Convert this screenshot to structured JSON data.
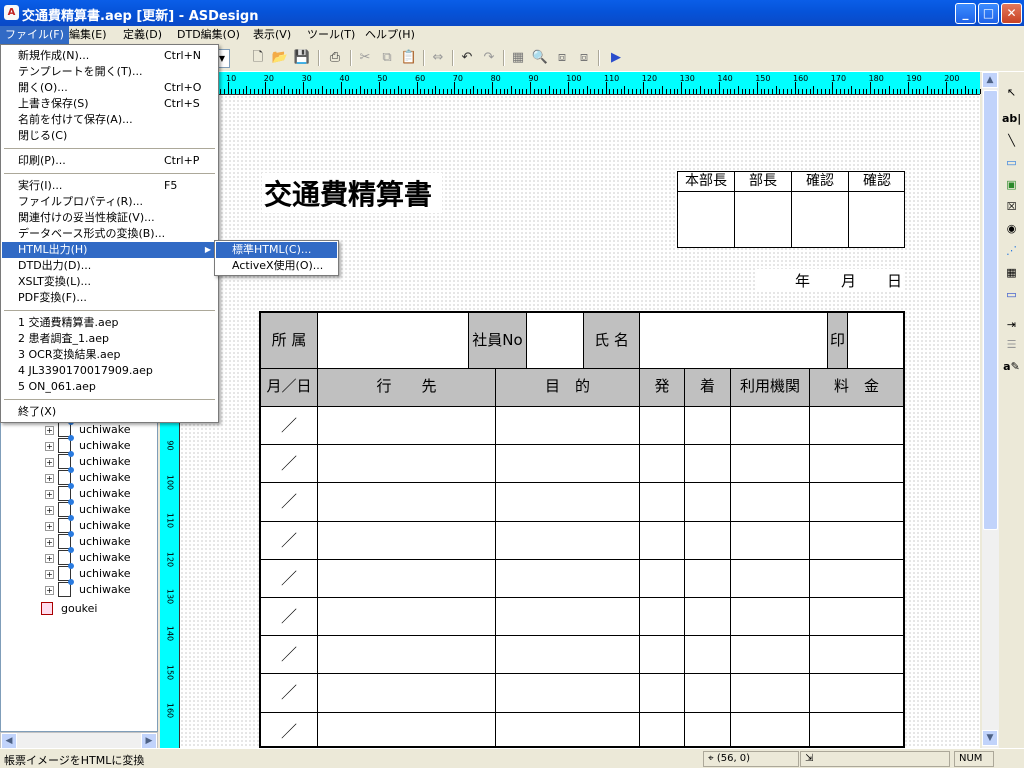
{
  "window": {
    "title": "交通費精算書.aep [更新] - ASDesign",
    "minimize": "_",
    "maximize": "□",
    "close": "✕"
  },
  "menubar": [
    {
      "label": "ファイル(F)"
    },
    {
      "label": "編集(E)"
    },
    {
      "label": "定義(D)"
    },
    {
      "label": "DTD編集(O)"
    },
    {
      "label": "表示(V)"
    },
    {
      "label": "ツール(T)"
    },
    {
      "label": "ヘルプ(H)"
    }
  ],
  "file_menu": {
    "group1": [
      {
        "label": "新規作成(N)...",
        "shortcut": "Ctrl+N"
      },
      {
        "label": "テンプレートを開く(T)...",
        "shortcut": ""
      },
      {
        "label": "開く(O)...",
        "shortcut": "Ctrl+O"
      },
      {
        "label": "上書き保存(S)",
        "shortcut": "Ctrl+S"
      },
      {
        "label": "名前を付けて保存(A)...",
        "shortcut": ""
      },
      {
        "label": "閉じる(C)",
        "shortcut": ""
      }
    ],
    "group2": [
      {
        "label": "印刷(P)...",
        "shortcut": "Ctrl+P"
      }
    ],
    "group3": [
      {
        "label": "実行(I)...",
        "shortcut": "F5"
      },
      {
        "label": "ファイルプロパティ(R)...",
        "shortcut": ""
      },
      {
        "label": "関連付けの妥当性検証(V)...",
        "shortcut": ""
      },
      {
        "label": "データベース形式の変換(B)...",
        "shortcut": ""
      },
      {
        "label": "HTML出力(H)",
        "shortcut": "",
        "highlighted": true,
        "has_submenu": true
      },
      {
        "label": "DTD出力(D)...",
        "shortcut": ""
      },
      {
        "label": "XSLT変換(L)...",
        "shortcut": ""
      },
      {
        "label": "PDF変換(F)...",
        "shortcut": ""
      }
    ],
    "recent": [
      {
        "label": "1 交通費精算書.aep"
      },
      {
        "label": "2 患者調査_1.aep"
      },
      {
        "label": "3 OCR変換結果.aep"
      },
      {
        "label": "4 JL3390170017909.aep"
      },
      {
        "label": "5 ON_061.aep"
      }
    ],
    "exit": {
      "label": "終了(X)"
    }
  },
  "html_submenu": [
    {
      "label": "標準HTML(C)...",
      "highlighted": true
    },
    {
      "label": "ActiveX使用(O)...",
      "highlighted": false
    }
  ],
  "tree": {
    "items": [
      "uchiwake",
      "uchiwake",
      "uchiwake",
      "uchiwake",
      "uchiwake",
      "uchiwake",
      "uchiwake",
      "uchiwake",
      "uchiwake",
      "uchiwake",
      "uchiwake"
    ],
    "last": "goukei"
  },
  "hruler": {
    "labels": [
      "10",
      "20",
      "30",
      "40",
      "50",
      "60",
      "70",
      "80",
      "90",
      "100",
      "110",
      "120",
      "130",
      "140",
      "150",
      "160",
      "170",
      "180",
      "190",
      "200"
    ]
  },
  "vruler": {
    "labels": [
      "90",
      "100",
      "110",
      "120",
      "130",
      "140",
      "150",
      "160"
    ]
  },
  "document": {
    "title": "交通費精算書",
    "approvals": [
      "本部長",
      "部長",
      "確認",
      "確認"
    ],
    "date": {
      "year": "年",
      "month": "月",
      "day": "日"
    },
    "header_row": {
      "dept": "所 属",
      "emp_no": "社員No",
      "name": "氏 名",
      "seal": "印"
    },
    "columns": [
      "月／日",
      "行　　先",
      "目　的",
      "発",
      "着",
      "利用機関",
      "料　金"
    ],
    "rows": [
      "／",
      "／",
      "／",
      "／",
      "／",
      "／",
      "／",
      "／",
      "／"
    ]
  },
  "status": {
    "message": "帳票イメージをHTMLに変換",
    "coords": "(56, 0)",
    "num": "NUM"
  }
}
